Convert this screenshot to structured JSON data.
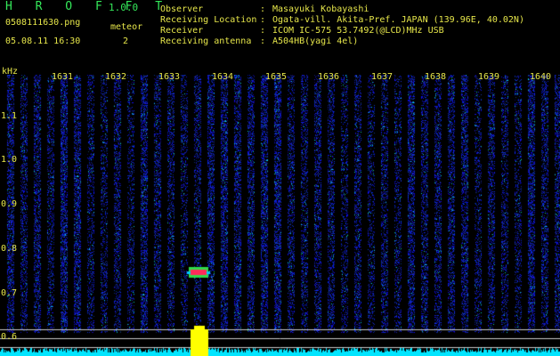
{
  "header": {
    "app_title": "H R O F F T",
    "app_version": "1.0.0",
    "filename": "0508111630.png",
    "datetime": "05.08.11 16:30",
    "meteor_label": "meteor",
    "meteor_count": "2",
    "info": [
      {
        "label": "Observer",
        "value": "Masayuki Kobayashi"
      },
      {
        "label": "Receiving Location",
        "value": "Ogata-vill. Akita-Pref. JAPAN (139.96E, 40.02N)"
      },
      {
        "label": "Receiver",
        "value": "ICOM IC-575 53.7492(@LCD)MHz USB"
      },
      {
        "label": "Receiving antenna",
        "value": "A504HB(yagi 4el)"
      }
    ]
  },
  "spectrogram": {
    "freq_unit": "kHz",
    "freq_ticks": [
      "1.1",
      "1.0",
      "0.9",
      "0.8",
      "0.7",
      "0.6"
    ],
    "time_ticks": [
      "1631",
      "1632",
      "1633",
      "1634",
      "1635",
      "1636",
      "1637",
      "1638",
      "1639",
      "1640"
    ],
    "colors": {
      "background": "#000000",
      "signal": "#1a3cff",
      "meteor": "#ff2a5a",
      "level": "#00e5ff",
      "peak": "#ffff00"
    }
  }
}
